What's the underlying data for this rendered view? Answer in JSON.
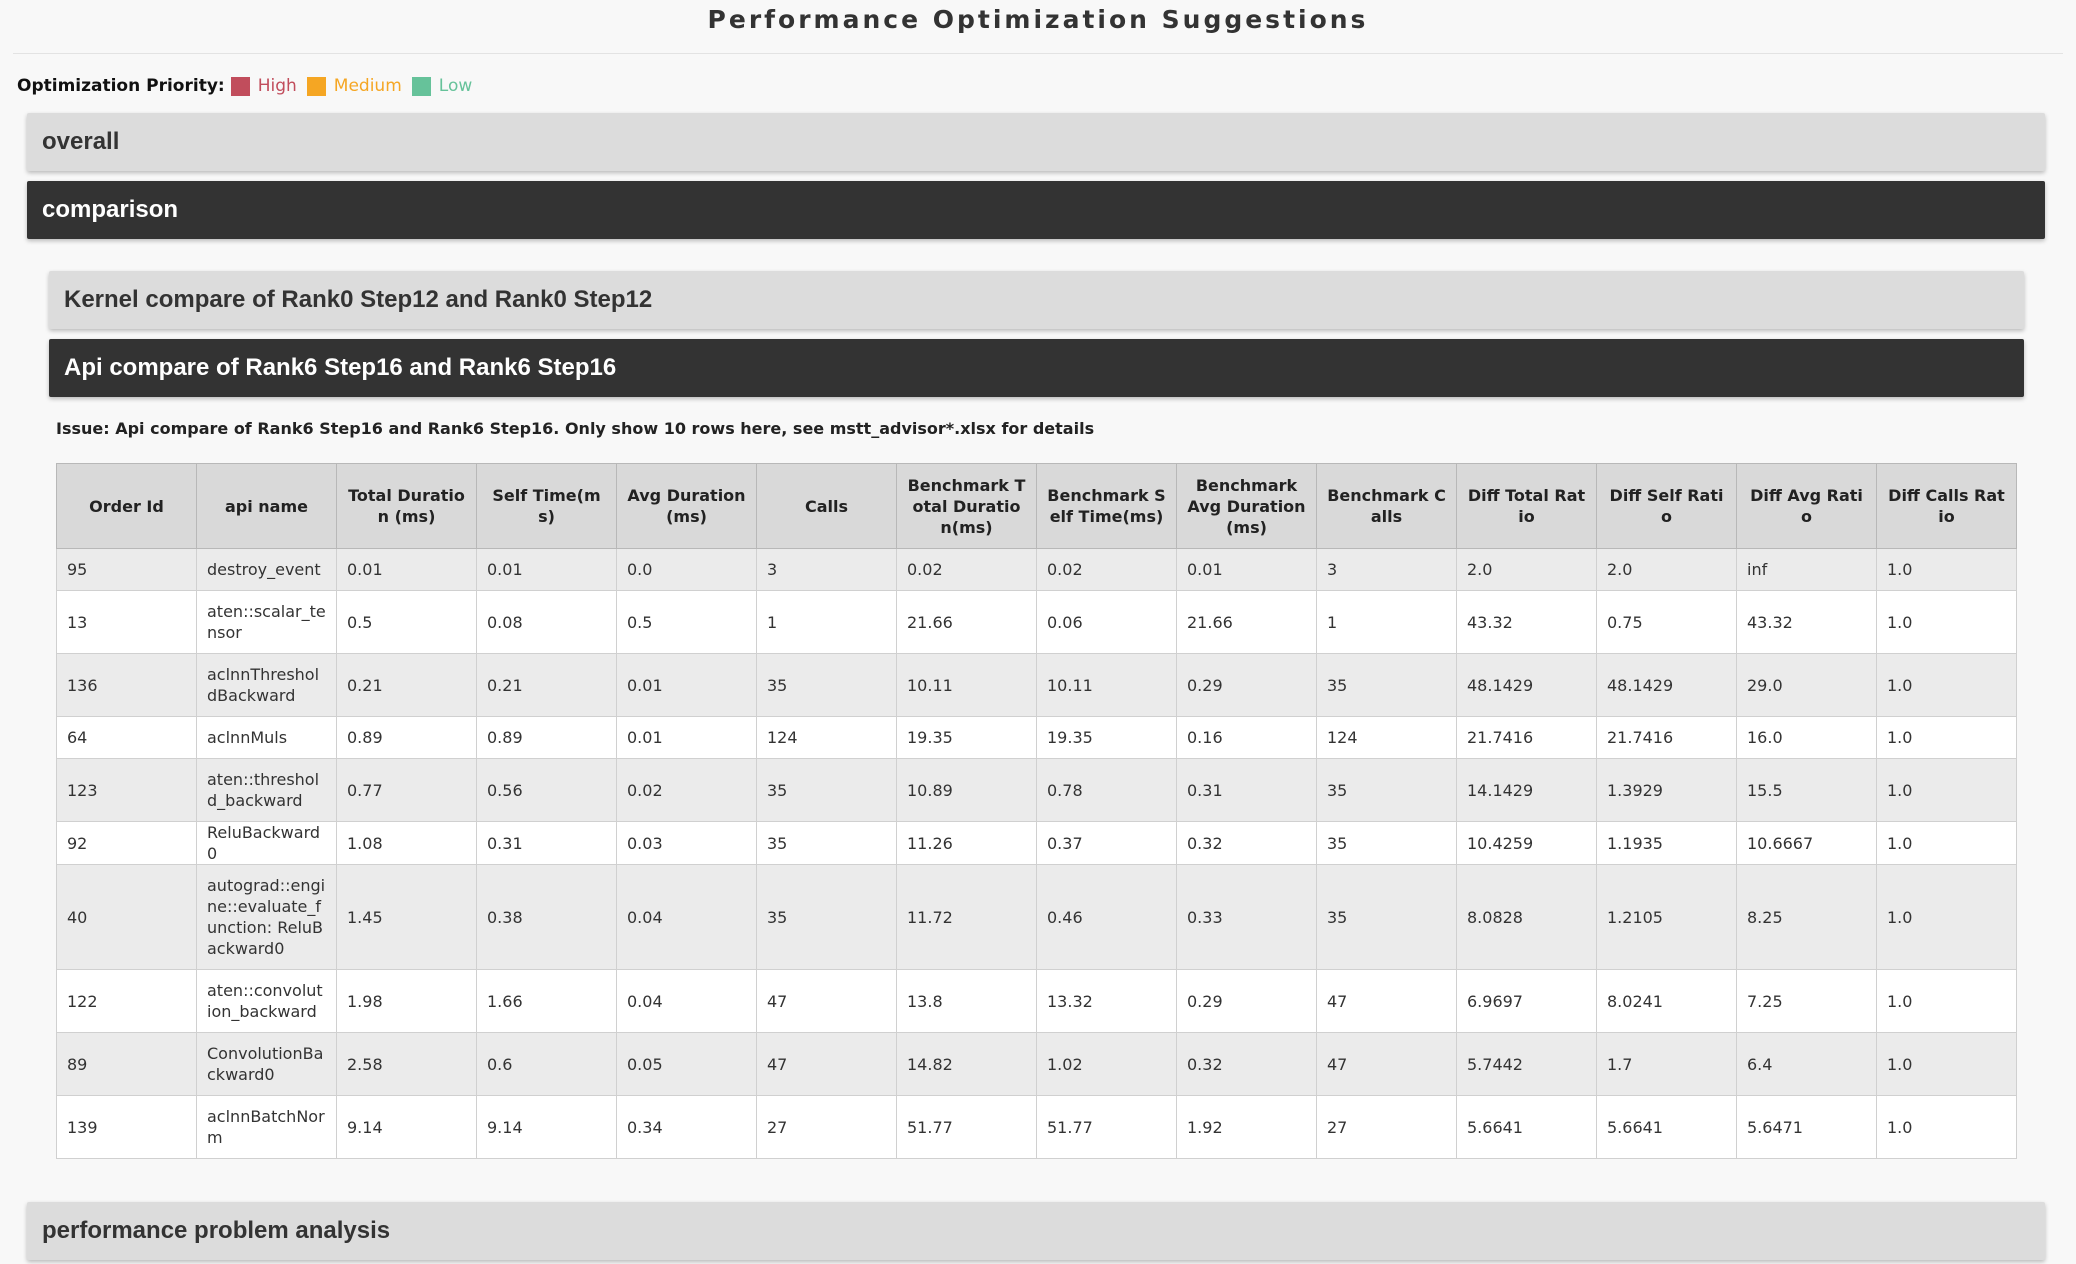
{
  "page": {
    "title": "Performance Optimization Suggestions"
  },
  "priority": {
    "label": "Optimization Priority:",
    "levels": [
      {
        "name": "High",
        "color": "#c14d5c"
      },
      {
        "name": "Medium",
        "color": "#f5a623"
      },
      {
        "name": "Low",
        "color": "#66c29a"
      }
    ]
  },
  "sections": {
    "overall": "overall",
    "comparison": "comparison",
    "kernel_compare": "Kernel compare of Rank0 Step12 and Rank0 Step12",
    "api_compare": "Api compare of Rank6 Step16 and Rank6 Step16",
    "perf_analysis": "performance problem analysis"
  },
  "issue": "Issue: Api compare of Rank6 Step16 and Rank6 Step16. Only show 10 rows here, see mstt_advisor*.xlsx for details",
  "table": {
    "headers": [
      "Order Id",
      "api name",
      "Total Duration (ms)",
      "Self Time(ms)",
      "Avg Duration (ms)",
      "Calls",
      "Benchmark Total Duration(ms)",
      "Benchmark Self Time(ms)",
      "Benchmark Avg Duration(ms)",
      "Benchmark Calls",
      "Diff Total Ratio",
      "Diff Self Ratio",
      "Diff Avg Ratio",
      "Diff Calls Ratio"
    ],
    "rows": [
      [
        "95",
        "destroy_event",
        "0.01",
        "0.01",
        "0.0",
        "3",
        "0.02",
        "0.02",
        "0.01",
        "3",
        "2.0",
        "2.0",
        "inf",
        "1.0"
      ],
      [
        "13",
        "aten::scalar_tensor",
        "0.5",
        "0.08",
        "0.5",
        "1",
        "21.66",
        "0.06",
        "21.66",
        "1",
        "43.32",
        "0.75",
        "43.32",
        "1.0"
      ],
      [
        "136",
        "aclnnThresholdBackward",
        "0.21",
        "0.21",
        "0.01",
        "35",
        "10.11",
        "10.11",
        "0.29",
        "35",
        "48.1429",
        "48.1429",
        "29.0",
        "1.0"
      ],
      [
        "64",
        "aclnnMuls",
        "0.89",
        "0.89",
        "0.01",
        "124",
        "19.35",
        "19.35",
        "0.16",
        "124",
        "21.7416",
        "21.7416",
        "16.0",
        "1.0"
      ],
      [
        "123",
        "aten::threshold_backward",
        "0.77",
        "0.56",
        "0.02",
        "35",
        "10.89",
        "0.78",
        "0.31",
        "35",
        "14.1429",
        "1.3929",
        "15.5",
        "1.0"
      ],
      [
        "92",
        "ReluBackward0",
        "1.08",
        "0.31",
        "0.03",
        "35",
        "11.26",
        "0.37",
        "0.32",
        "35",
        "10.4259",
        "1.1935",
        "10.6667",
        "1.0"
      ],
      [
        "40",
        "autograd::engine::evaluate_function: ReluBackward0",
        "1.45",
        "0.38",
        "0.04",
        "35",
        "11.72",
        "0.46",
        "0.33",
        "35",
        "8.0828",
        "1.2105",
        "8.25",
        "1.0"
      ],
      [
        "122",
        "aten::convolution_backward",
        "1.98",
        "1.66",
        "0.04",
        "47",
        "13.8",
        "13.32",
        "0.29",
        "47",
        "6.9697",
        "8.0241",
        "7.25",
        "1.0"
      ],
      [
        "89",
        "ConvolutionBackward0",
        "2.58",
        "0.6",
        "0.05",
        "47",
        "14.82",
        "1.02",
        "0.32",
        "47",
        "5.7442",
        "1.7",
        "6.4",
        "1.0"
      ],
      [
        "139",
        "aclnnBatchNorm",
        "9.14",
        "9.14",
        "0.34",
        "27",
        "51.77",
        "51.77",
        "1.92",
        "27",
        "5.6641",
        "5.6641",
        "5.6471",
        "1.0"
      ]
    ]
  }
}
